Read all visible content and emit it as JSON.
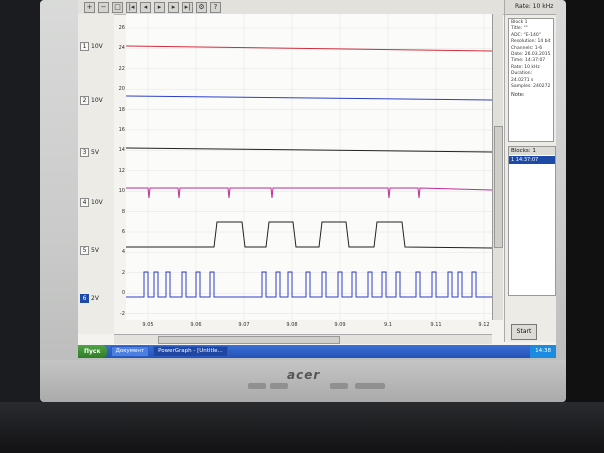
{
  "brand": "acer",
  "toolbar_icons": [
    "zoom-in-icon",
    "zoom-out-icon",
    "zoom-fit-icon",
    "first-icon",
    "prev-icon",
    "play-icon",
    "next-icon",
    "last-icon",
    "settings-icon",
    "help-icon"
  ],
  "channels": [
    {
      "num": "1",
      "volts": "10V",
      "color": "#d02c3a"
    },
    {
      "num": "2",
      "volts": "10V",
      "color": "#2c3fc8"
    },
    {
      "num": "3",
      "volts": "5V",
      "color": "#222222"
    },
    {
      "num": "4",
      "volts": "10V",
      "color": "#c02a9a"
    },
    {
      "num": "5",
      "volts": "5V",
      "color": "#222222"
    },
    {
      "num": "6",
      "volts": "2V",
      "color": "#2c3fc8"
    }
  ],
  "y_ticks": [
    "26",
    "24",
    "22",
    "20",
    "18",
    "16",
    "14",
    "12",
    "10",
    "8",
    "6",
    "4",
    "2",
    "0",
    "-2"
  ],
  "x_ticks": [
    "9.05",
    "9.06",
    "9.07",
    "9.08",
    "9.09",
    "9.1",
    "9.11",
    "9.12"
  ],
  "panel": {
    "rate": "Rate: 10 kHz",
    "info_lines": [
      "Block 1",
      "Title: \"\"",
      "ADC: \"E-140\"",
      "Resolution: 14 bit",
      "Channels: 1-6",
      "Date: 26.03.2015",
      "Time: 14:37:07",
      "Rate: 10 kHz",
      "Duration: 24.0271 s",
      "Samples: 240272"
    ],
    "note_label": "Note:",
    "blocks_header": "Blocks: 1",
    "block_row": "1    14:37:07",
    "start_button": "Start"
  },
  "taskbar": {
    "start": "Пуск",
    "tasks": [
      "Документ",
      "PowerGraph - [Untitle..."
    ],
    "clock": "14:38"
  }
}
